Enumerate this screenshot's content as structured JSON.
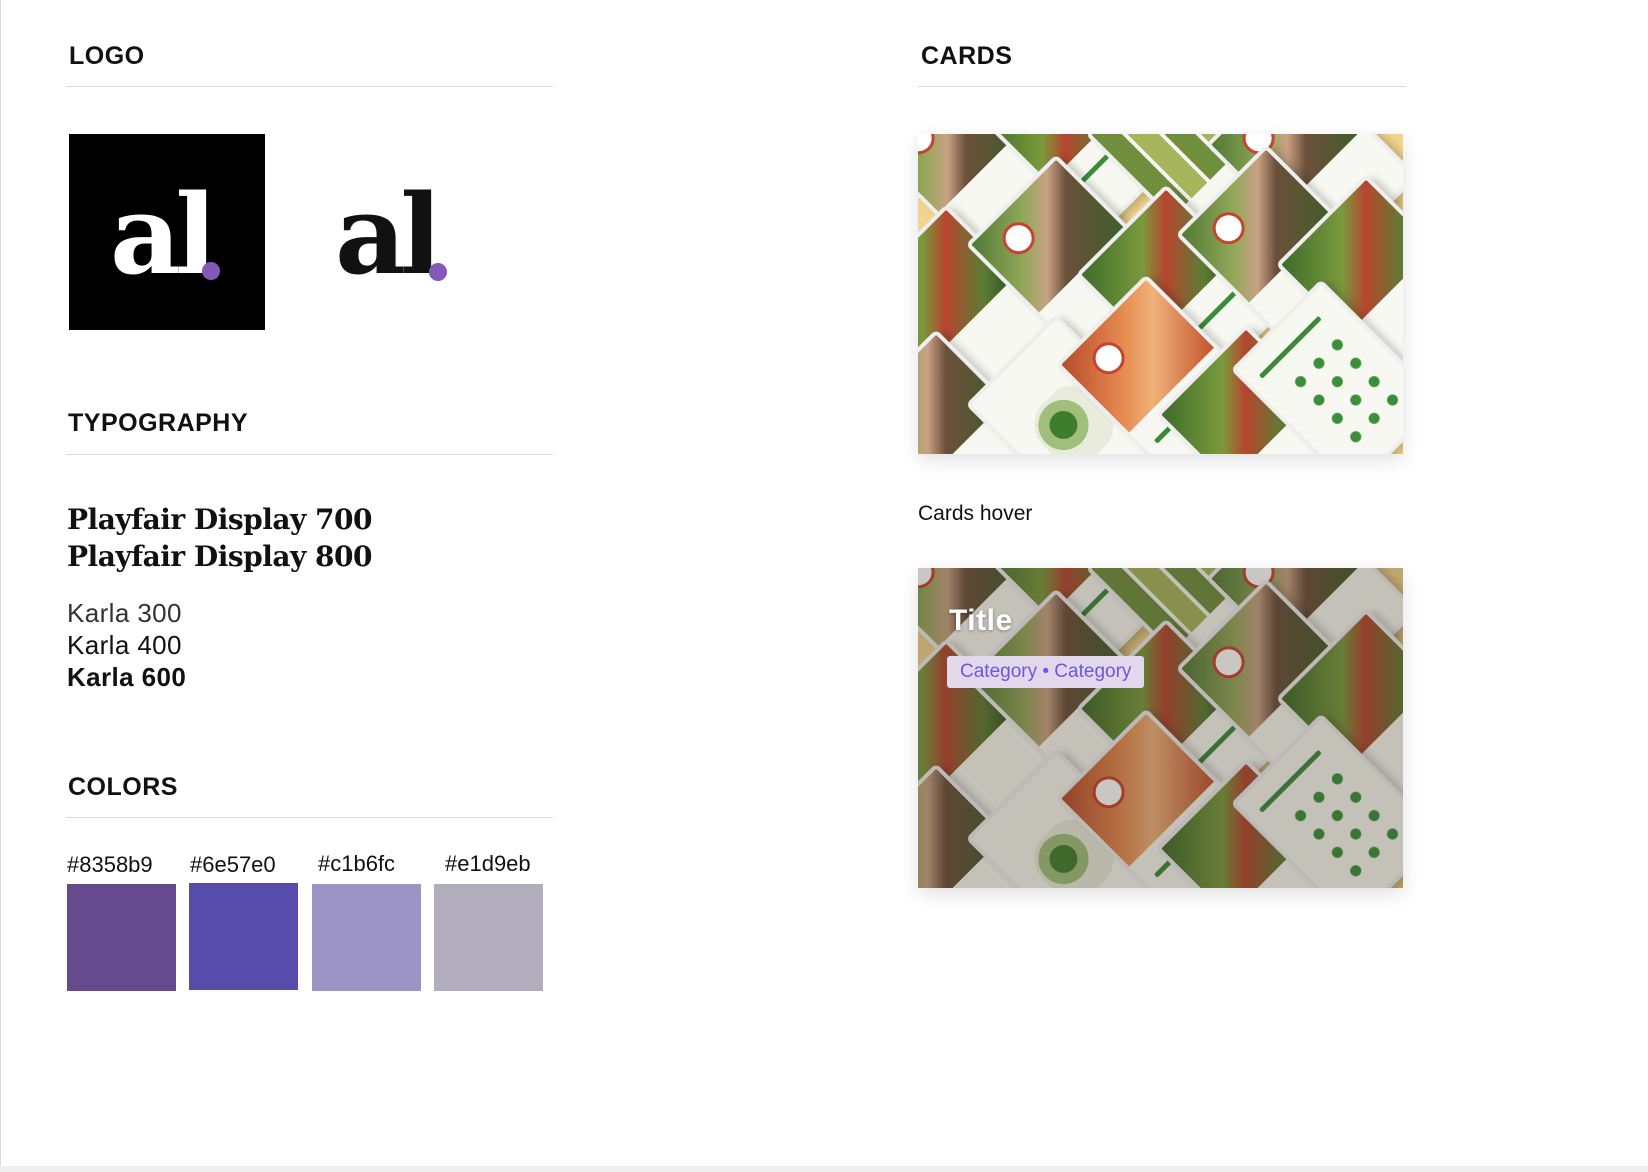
{
  "logo": {
    "heading": "LOGO",
    "mark_dark": "al",
    "mark_light": "al",
    "dot_color": "#8358b9"
  },
  "typography": {
    "heading": "TYPOGRAPHY",
    "serif_samples": [
      "Playfair Display 700",
      "Playfair Display 800"
    ],
    "sans_samples": [
      "Karla 300",
      "Karla 400",
      "Karla 600"
    ]
  },
  "colors": {
    "heading": "COLORS",
    "swatches": [
      {
        "label": "#8358b9",
        "hex": "#664a8e"
      },
      {
        "label": "#6e57e0",
        "hex": "#574cab"
      },
      {
        "label": "#c1b6fc",
        "hex": "#9b94c5"
      },
      {
        "label": "#e1d9eb",
        "hex": "#b2adbd"
      }
    ]
  },
  "cards": {
    "heading": "CARDS",
    "hover_caption": "Cards hover",
    "hover_title": "Title",
    "hover_category": "Category • Category",
    "tag_bg": "#e1d9eb",
    "tag_text_color": "#6e57e0"
  }
}
